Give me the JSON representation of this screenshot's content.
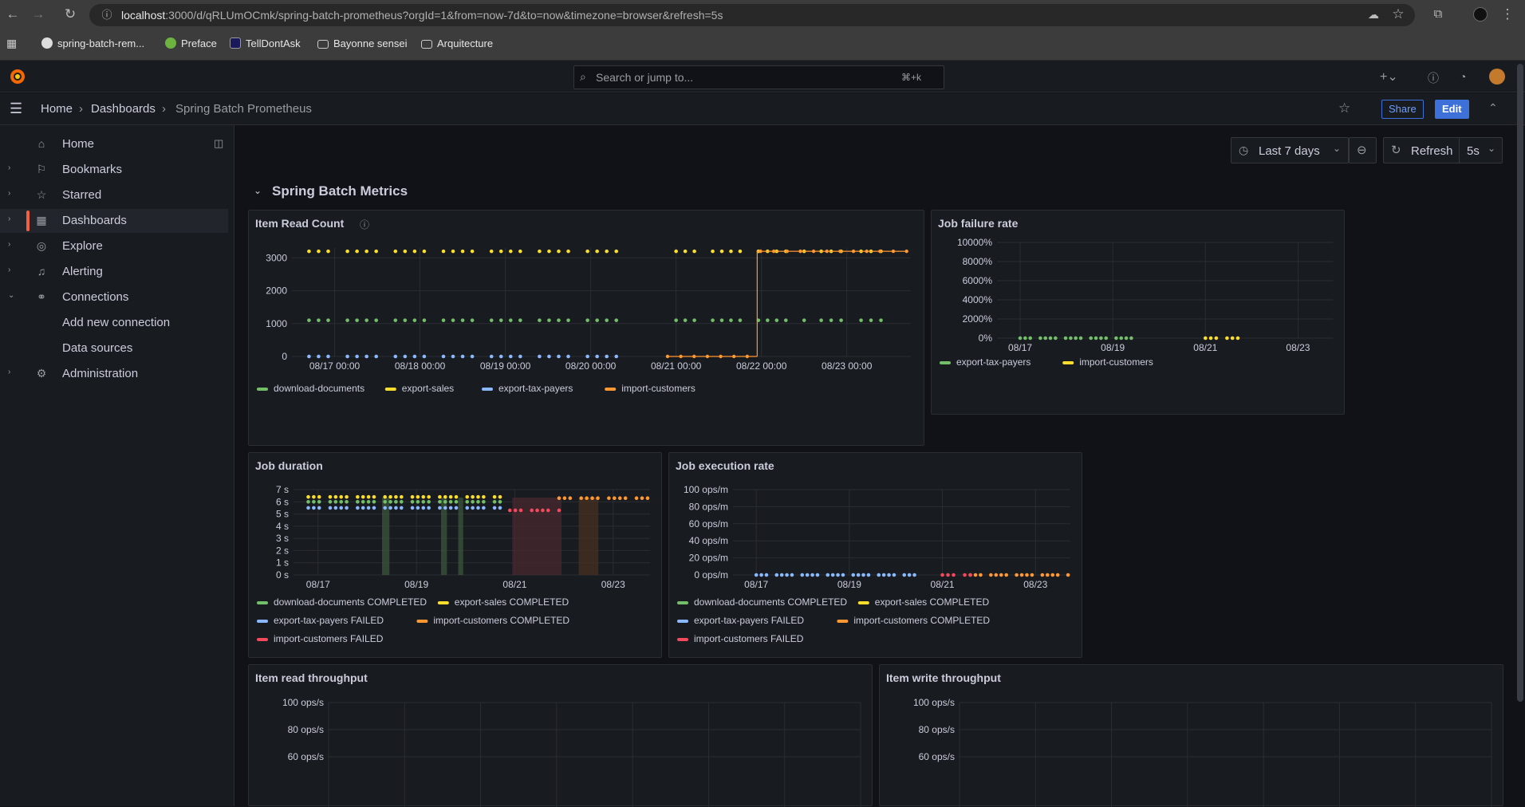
{
  "browser": {
    "url_host": "localhost",
    "url_rest": ":3000/d/qRLUmOCmk/spring-batch-prometheus?orgId=1&from=now-7d&to=now&timezone=browser&refresh=5s",
    "bookmarks": [
      {
        "label": "spring-batch-rem...",
        "icon": "github-icon"
      },
      {
        "label": "Preface",
        "icon": "leaf-icon"
      },
      {
        "label": "TellDontAsk",
        "icon": "f-icon"
      },
      {
        "label": "Bayonne sensei",
        "icon": "folder-icon"
      },
      {
        "label": "Arquitecture",
        "icon": "folder-icon"
      }
    ]
  },
  "topbar": {
    "search_placeholder": "Search or jump to...",
    "shortcut": "⌘+k"
  },
  "breadcrumb": {
    "home": "Home",
    "dashboards": "Dashboards",
    "current": "Spring Batch Prometheus"
  },
  "actions": {
    "share": "Share",
    "edit": "Edit"
  },
  "sidebar": {
    "items": [
      {
        "label": "Home",
        "icon": "home-icon",
        "chev": ""
      },
      {
        "label": "Bookmarks",
        "icon": "bookmark-icon",
        "chev": "›"
      },
      {
        "label": "Starred",
        "icon": "star-icon",
        "chev": "›"
      },
      {
        "label": "Dashboards",
        "icon": "apps-icon",
        "chev": "›"
      },
      {
        "label": "Explore",
        "icon": "compass-icon",
        "chev": "›"
      },
      {
        "label": "Alerting",
        "icon": "bell-icon",
        "chev": "›"
      },
      {
        "label": "Connections",
        "icon": "link-icon",
        "chev": "⌄"
      },
      {
        "label": "Add new connection",
        "icon": "",
        "chev": ""
      },
      {
        "label": "Data sources",
        "icon": "",
        "chev": ""
      },
      {
        "label": "Administration",
        "icon": "cog-icon",
        "chev": "›"
      }
    ]
  },
  "controls": {
    "time_range": "Last 7 days",
    "refresh": "Refresh",
    "interval": "5s"
  },
  "row": {
    "title": "Spring Batch Metrics"
  },
  "colors": {
    "green": "#73bf69",
    "yellow": "#fade2a",
    "blue": "#8ab8ff",
    "orange": "#ff9830",
    "red": "#f2495c"
  },
  "panels": {
    "item_read_count": {
      "title": "Item Read Count"
    },
    "job_failure_rate": {
      "title": "Job failure rate"
    },
    "job_duration": {
      "title": "Job duration"
    },
    "job_execution_rate": {
      "title": "Job execution rate"
    },
    "item_read_throughput": {
      "title": "Item read throughput"
    },
    "item_write_throughput": {
      "title": "Item write throughput"
    }
  },
  "chart_data": [
    {
      "id": "item_read_count",
      "type": "line",
      "title": "Item Read Count",
      "xticks": [
        "08/17 00:00",
        "08/18 00:00",
        "08/19 00:00",
        "08/20 00:00",
        "08/21 00:00",
        "08/22 00:00",
        "08/23 00:00"
      ],
      "yticks": [
        "0",
        "1000",
        "2000",
        "3000"
      ],
      "ylim": [
        0,
        3300
      ],
      "series": [
        {
          "name": "download-documents",
          "color": "green",
          "value": 1100,
          "segments": [
            [
              16.7,
              20.3
            ],
            [
              21.0,
              22.5
            ],
            [
              22.7,
              23.4
            ]
          ]
        },
        {
          "name": "export-sales",
          "color": "yellow",
          "value": 3200,
          "segments": [
            [
              16.7,
              20.3
            ],
            [
              21.0,
              22.5
            ],
            [
              22.7,
              23.4
            ]
          ]
        },
        {
          "name": "export-tax-payers",
          "color": "blue",
          "value": 0,
          "segments": [
            [
              16.7,
              20.3
            ]
          ]
        },
        {
          "name": "import-customers",
          "color": "orange",
          "value": 0,
          "step_at": 21.95,
          "value_after": 3200,
          "segments": [
            [
              20.9,
              23.7
            ]
          ]
        }
      ]
    },
    {
      "id": "job_failure_rate",
      "type": "line",
      "title": "Job failure rate",
      "xticks": [
        "08/17",
        "08/19",
        "08/21",
        "08/23"
      ],
      "yticks": [
        "0%",
        "2000%",
        "4000%",
        "6000%",
        "8000%",
        "10000%"
      ],
      "ylim": [
        0,
        10000
      ],
      "series": [
        {
          "name": "export-tax-payers",
          "color": "green",
          "value": 0,
          "segments": [
            [
              17.0,
              19.4
            ]
          ]
        },
        {
          "name": "import-customers",
          "color": "yellow",
          "value": 0,
          "segments": [
            [
              21.0,
              21.7
            ]
          ]
        }
      ]
    },
    {
      "id": "job_duration",
      "type": "line",
      "title": "Job duration",
      "xticks": [
        "08/17",
        "08/19",
        "08/21",
        "08/23"
      ],
      "yticks": [
        "0 s",
        "1 s",
        "2 s",
        "3 s",
        "4 s",
        "5 s",
        "6 s",
        "7 s"
      ],
      "ylim": [
        0,
        7
      ],
      "series": [
        {
          "name": "download-documents COMPLETED",
          "color": "green",
          "value": 6.0,
          "segments": [
            [
              16.8,
              20.7
            ]
          ]
        },
        {
          "name": "export-sales COMPLETED",
          "color": "yellow",
          "value": 6.4,
          "segments": [
            [
              16.8,
              20.7
            ]
          ]
        },
        {
          "name": "export-tax-payers FAILED",
          "color": "blue",
          "value": 5.5,
          "segments": [
            [
              16.8,
              20.7
            ]
          ]
        },
        {
          "name": "import-customers COMPLETED",
          "color": "orange",
          "value": 6.3,
          "segments": [
            [
              21.9,
              23.7
            ]
          ]
        },
        {
          "name": "import-customers FAILED",
          "color": "red",
          "value": 5.3,
          "segments": [
            [
              20.9,
              21.9
            ]
          ]
        }
      ]
    },
    {
      "id": "job_execution_rate",
      "type": "line",
      "title": "Job execution rate",
      "xticks": [
        "08/17",
        "08/19",
        "08/21",
        "08/23"
      ],
      "yticks": [
        "0 ops/m",
        "20 ops/m",
        "40 ops/m",
        "60 ops/m",
        "80 ops/m",
        "100 ops/m"
      ],
      "ylim": [
        0,
        100
      ],
      "series": [
        {
          "name": "download-documents COMPLETED",
          "color": "green",
          "value": 0,
          "segments": []
        },
        {
          "name": "export-sales COMPLETED",
          "color": "yellow",
          "value": 0,
          "segments": []
        },
        {
          "name": "export-tax-payers FAILED",
          "color": "blue",
          "value": 0,
          "segments": [
            [
              17.0,
              20.4
            ]
          ]
        },
        {
          "name": "import-customers COMPLETED",
          "color": "orange",
          "value": 0,
          "segments": [
            [
              21.6,
              23.7
            ]
          ]
        },
        {
          "name": "import-customers FAILED",
          "color": "red",
          "value": 0,
          "segments": [
            [
              21.0,
              21.6
            ]
          ]
        }
      ]
    },
    {
      "id": "item_read_throughput",
      "type": "line",
      "title": "Item read throughput",
      "yticks": [
        "60 ops/s",
        "80 ops/s",
        "100 ops/s"
      ],
      "ylim": [
        0,
        100
      ],
      "series": []
    },
    {
      "id": "item_write_throughput",
      "type": "line",
      "title": "Item write throughput",
      "yticks": [
        "60 ops/s",
        "80 ops/s",
        "100 ops/s"
      ],
      "ylim": [
        0,
        100
      ],
      "series": []
    }
  ]
}
